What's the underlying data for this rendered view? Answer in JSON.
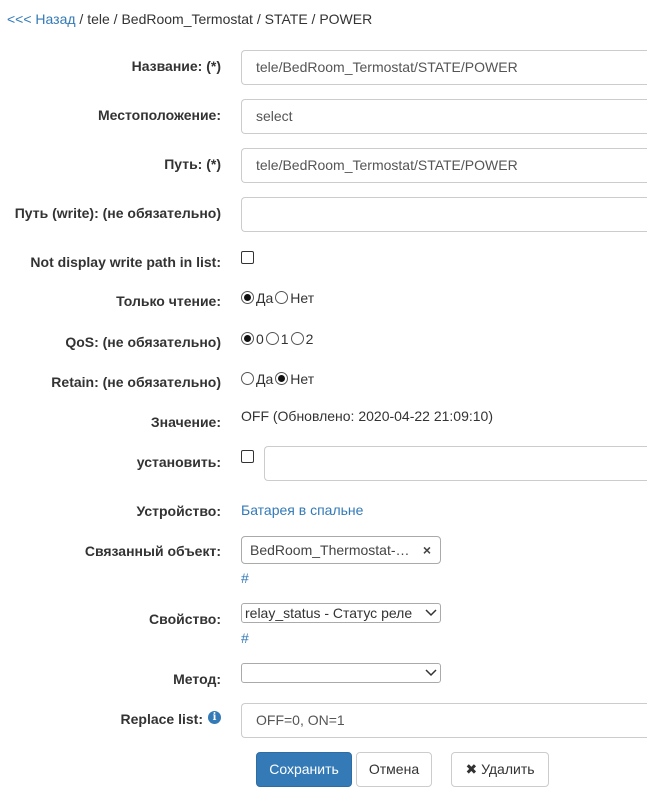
{
  "breadcrumb": {
    "back_label": "<<< Назад",
    "path": "/ tele / BedRoom_Termostat / STATE / POWER"
  },
  "form": {
    "name": {
      "label": "Название: (*)",
      "value": "tele/BedRoom_Termostat/STATE/POWER"
    },
    "location": {
      "label": "Местоположение:",
      "value": "select"
    },
    "path": {
      "label": "Путь: (*)",
      "value": "tele/BedRoom_Termostat/STATE/POWER"
    },
    "path_write": {
      "label": "Путь (write): (не обязательно)",
      "value": ""
    },
    "not_display_write": {
      "label": "Not display write path in list:",
      "checked": false
    },
    "read_only": {
      "label": "Только чтение:",
      "options": [
        "Да",
        "Нет"
      ],
      "selected": "Да"
    },
    "qos": {
      "label": "QoS: (не обязательно)",
      "options": [
        "0",
        "1",
        "2"
      ],
      "selected": "0"
    },
    "retain": {
      "label": "Retain: (не обязательно)",
      "options": [
        "Да",
        "Нет"
      ],
      "selected": "Нет"
    },
    "value": {
      "label": "Значение:",
      "text": "OFF (Обновлено: 2020-04-22 21:09:10)"
    },
    "set": {
      "label": "установить:",
      "checked": false,
      "value": ""
    },
    "device": {
      "label": "Устройство:",
      "link": "Батарея в спальне"
    },
    "linked_object": {
      "label": "Связанный объект:",
      "value": "BedRoom_Thermostat-…",
      "clear": "×",
      "hash": "#"
    },
    "property": {
      "label": "Свойство:",
      "value": "relay_status - Статус реле",
      "hash": "#"
    },
    "method": {
      "label": "Метод:",
      "value": ""
    },
    "replace_list": {
      "label": "Replace list:",
      "info": "i",
      "value": "OFF=0, ON=1"
    }
  },
  "buttons": {
    "save": "Сохранить",
    "cancel": "Отмена",
    "delete": "Удалить",
    "delete_icon": "✖"
  },
  "colors": {
    "primary": "#337ab7",
    "link": "#337ab7"
  }
}
